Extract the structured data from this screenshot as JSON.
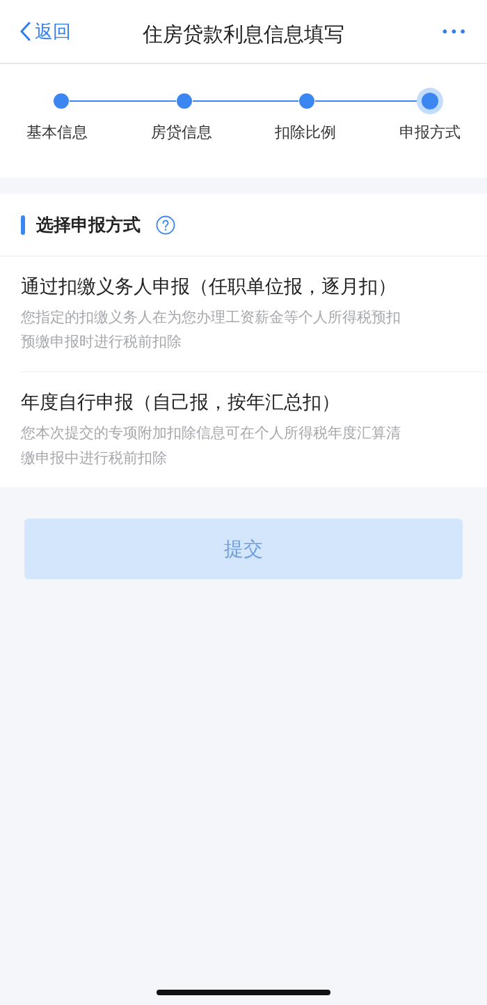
{
  "nav": {
    "back": "返回",
    "title": "住房贷款利息信息填写",
    "more": "•••"
  },
  "steps": [
    {
      "label": "基本信息",
      "current": false
    },
    {
      "label": "房贷信息",
      "current": false
    },
    {
      "label": "扣除比例",
      "current": false
    },
    {
      "label": "申报方式",
      "current": true
    }
  ],
  "section": {
    "title": "选择申报方式"
  },
  "options": [
    {
      "title": "通过扣缴义务人申报（任职单位报，逐月扣）",
      "description": "您指定的扣缴义务人在为您办理工资薪金等个人所得税预扣预缴申报时进行税前扣除"
    },
    {
      "title": "年度自行申报（自己报，按年汇总扣）",
      "description": "您本次提交的专项附加扣除信息可在个人所得税年度汇算清缴申报中进行税前扣除"
    }
  ],
  "submit": {
    "label": "提交",
    "disabled": true
  }
}
